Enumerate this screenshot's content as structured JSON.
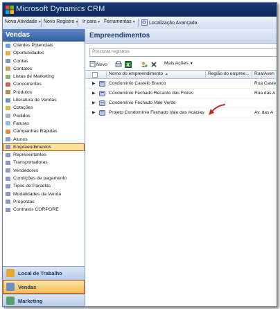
{
  "window": {
    "title": "Microsoft Dynamics CRM"
  },
  "menubar": {
    "items": [
      {
        "label": "Nova Atividade"
      },
      {
        "label": "Novo Registro"
      },
      {
        "label": "Ir para"
      },
      {
        "label": "Ferramentas"
      },
      {
        "label": "Localização Avançada"
      }
    ]
  },
  "sidebar": {
    "title": "Vendas",
    "items": [
      {
        "label": "Clientes Potenciais"
      },
      {
        "label": "Oportunidades"
      },
      {
        "label": "Contas"
      },
      {
        "label": "Contatos"
      },
      {
        "label": "Listas de Marketing"
      },
      {
        "label": "Concorrentes"
      },
      {
        "label": "Produtos"
      },
      {
        "label": "Literatura de Vendas"
      },
      {
        "label": "Cotações"
      },
      {
        "label": "Pedidos"
      },
      {
        "label": "Faturas"
      },
      {
        "label": "Campanhas Rápidas"
      },
      {
        "label": "Alunos"
      },
      {
        "label": "Empreendimentos"
      },
      {
        "label": "Representantes"
      },
      {
        "label": "Transportadoras"
      },
      {
        "label": "Vendedores"
      },
      {
        "label": "Condições de pagamento"
      },
      {
        "label": "Tipos de Parcelas"
      },
      {
        "label": "Modalidades da Venda"
      },
      {
        "label": "Propostas"
      },
      {
        "label": "Contratos CORPORE"
      }
    ],
    "selected_item": "Empreendimentos",
    "workspaces": [
      {
        "label": "Local de Trabalho"
      },
      {
        "label": "Vendas"
      },
      {
        "label": "Marketing"
      }
    ],
    "selected_workspace": "Vendas"
  },
  "main": {
    "title": "Empreendimentos",
    "search": {
      "placeholder": "Procurar registros",
      "value": ""
    },
    "toolbar": {
      "new_label": "Novo",
      "more_actions_label": "Mais Ações"
    },
    "grid": {
      "columns": [
        "Nome do empreendimento",
        "Região do empree...",
        "Rua/Aven"
      ],
      "sort_column": "Nome do empreendimento",
      "rows": [
        {
          "name": "Condomínio Castelo Branco",
          "region": "",
          "street": "Rua Caste"
        },
        {
          "name": "Condomínio Fechado Recanto das Flores",
          "region": "",
          "street": "Rua das A"
        },
        {
          "name": "Condomínio Fechado Vale Verde",
          "region": "",
          "street": ""
        },
        {
          "name": "Projeto Condomínio Fechado Vale das Acácias",
          "region": "",
          "street": "Av. das A"
        }
      ]
    }
  },
  "colors": {
    "accent": "#d8531a",
    "header_blue": "#335f9e",
    "selection": "#fbe39c"
  }
}
